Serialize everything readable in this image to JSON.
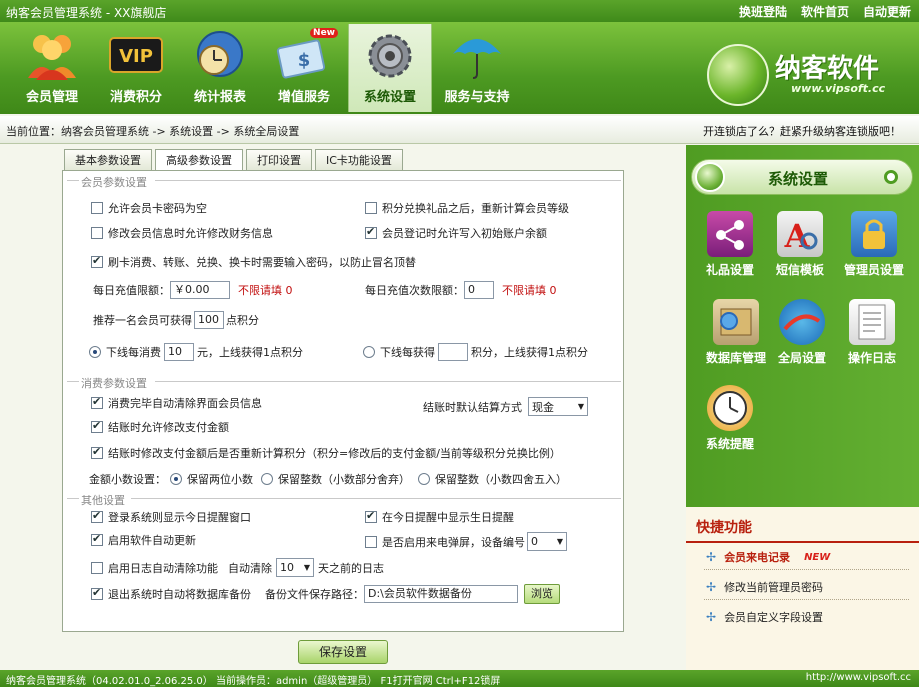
{
  "window": {
    "title": "纳客会员管理系统 - XX旗舰店",
    "top_links": [
      "换班登陆",
      "软件首页",
      "自动更新"
    ]
  },
  "nav": {
    "items": [
      {
        "label": "会员管理",
        "icon": "members-icon"
      },
      {
        "label": "消费积分",
        "icon": "vip-icon"
      },
      {
        "label": "统计报表",
        "icon": "clock-report-icon"
      },
      {
        "label": "增值服务",
        "icon": "value-added-icon",
        "badge": "New"
      },
      {
        "label": "系统设置",
        "icon": "gear-settings-icon",
        "active": true
      },
      {
        "label": "服务与支持",
        "icon": "umbrella-icon"
      }
    ]
  },
  "brand": {
    "name": "纳客软件",
    "url": "www.vipsoft.cc"
  },
  "breadcrumb": {
    "text": "当前位置：纳客会员管理系统 -> 系统设置 -> 系统全局设置",
    "upgrade": "开连锁店了么？赶紧升级纳客连锁版吧！"
  },
  "tabs": [
    "基本参数设置",
    "高级参数设置",
    "打印设置",
    "IC卡功能设置"
  ],
  "member_section": {
    "title": "会员参数设置",
    "allow_empty_password": {
      "label": "允许会员卡密码为空",
      "checked": false
    },
    "recalc_level_after_gift": {
      "label": "积分兑换礼品之后，重新计算会员等级",
      "checked": false
    },
    "allow_edit_finance": {
      "label": "修改会员信息时允许修改财务信息",
      "checked": false
    },
    "allow_initial_balance": {
      "label": "会员登记时允许写入初始账户余额",
      "checked": true
    },
    "require_password": {
      "label": "刷卡消费、转账、兑换、换卡时需要输入密码，以防止冒名顶替",
      "checked": true
    },
    "daily_recharge_limit_label": "每日充值限额：",
    "daily_recharge_limit_value": "￥0.00",
    "unlimited_hint_1": "不限请填 0",
    "daily_recharge_count_label": "每日充值次数限额：",
    "daily_recharge_count_value": "0",
    "unlimited_hint_2": "不限请填 0",
    "referral_prefix": "推荐一名会员可获得",
    "referral_value": "100",
    "referral_suffix": "点积分",
    "downline_spend_prefix": "下线每消费",
    "downline_spend_value": "10",
    "downline_spend_suffix": "元，上线获得1点积分",
    "downline_earn_prefix": "下线每获得",
    "downline_earn_value": "",
    "downline_earn_suffix": "积分，上线获得1点积分"
  },
  "consume_section": {
    "title": "消费参数设置",
    "clear_after_consume": {
      "label": "消费完毕自动清除界面会员信息",
      "checked": true
    },
    "allow_edit_payment": {
      "label": "结账时允许修改支付金额",
      "checked": true
    },
    "recalc_points": {
      "label": "结账时修改支付金额后是否重新计算积分（积分=修改后的支付金额/当前等级积分兑换比例）",
      "checked": true
    },
    "default_method_label": "结账时默认结算方式",
    "default_method_value": "现金",
    "decimal_label": "金额小数设置：",
    "decimal_options": [
      {
        "label": "保留两位小数",
        "checked": true
      },
      {
        "label": "保留整数（小数部分舍弃）",
        "checked": false
      },
      {
        "label": "保留整数（小数四舍五入）",
        "checked": false
      }
    ]
  },
  "other_section": {
    "title": "其他设置",
    "show_reminder": {
      "label": "登录系统则显示今日提醒窗口",
      "checked": true
    },
    "show_birthday": {
      "label": "在今日提醒中显示生日提醒",
      "checked": true
    },
    "auto_update": {
      "label": "启用软件自动更新",
      "checked": true
    },
    "caller_popup": {
      "label": "是否启用来电弹屏，设备编号",
      "checked": false
    },
    "device_value": "0",
    "auto_clear_log": {
      "label": "启用日志自动清除功能",
      "checked": false
    },
    "auto_clear_prefix": "自动清除",
    "auto_clear_value": "10",
    "auto_clear_suffix": "天之前的日志",
    "auto_backup": {
      "label": "退出系统时自动将数据库备份",
      "checked": true
    },
    "backup_path_label": "备份文件保存路径：",
    "backup_path_value": "D:\\会员软件数据备份",
    "browse_label": "浏览"
  },
  "save_label": "保存设置",
  "sidebar": {
    "title": "系统设置",
    "items": [
      {
        "label": "礼品设置",
        "icon": "gift-icon"
      },
      {
        "label": "短信模板",
        "icon": "sms-template-icon"
      },
      {
        "label": "管理员设置",
        "icon": "admin-lock-icon"
      },
      {
        "label": "数据库管理",
        "icon": "database-icon"
      },
      {
        "label": "全局设置",
        "icon": "global-icon"
      },
      {
        "label": "操作日志",
        "icon": "log-icon"
      },
      {
        "label": "系统提醒",
        "icon": "clock-reminder-icon"
      }
    ]
  },
  "quick": {
    "title": "快捷功能",
    "items": [
      "会员来电记录",
      "修改当前管理员密码",
      "会员自定义字段设置"
    ],
    "new_badge": "NEW"
  },
  "status": {
    "left": "纳客会员管理系统（04.02.01.0_2.06.25.0） 当前操作员：admin（超级管理员） F1打开官网 Ctrl+F12锁屏",
    "right": "http://www.vipsoft.cc"
  },
  "colors": {
    "accent": "#4d9a22",
    "hint_red": "#c21010",
    "quick_red": "#b8200e"
  }
}
